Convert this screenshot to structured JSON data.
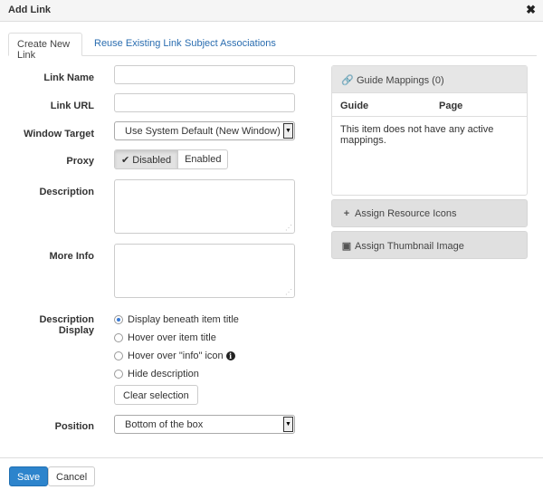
{
  "dialog": {
    "title": "Add Link",
    "close_glyph": "✖"
  },
  "tabs": [
    {
      "label": "Create New Link",
      "active": true
    },
    {
      "label": "Reuse Existing Link",
      "active": false
    },
    {
      "label": "Subject Associations",
      "active": false
    }
  ],
  "form": {
    "link_name": {
      "label": "Link Name",
      "value": ""
    },
    "link_url": {
      "label": "Link URL",
      "value": ""
    },
    "window_target": {
      "label": "Window Target",
      "selected": "Use System Default (New Window)"
    },
    "proxy": {
      "label": "Proxy",
      "options": [
        "Disabled",
        "Enabled"
      ],
      "selected": "Disabled"
    },
    "description": {
      "label": "Description",
      "value": ""
    },
    "more_info": {
      "label": "More Info",
      "value": ""
    },
    "description_display": {
      "label": "Description Display",
      "options": [
        "Display beneath item title",
        "Hover over item title",
        "Hover over \"info\" icon",
        "Hide description"
      ],
      "selected": "Display beneath item title",
      "clear_label": "Clear selection"
    },
    "position": {
      "label": "Position",
      "selected": "Bottom of the box"
    }
  },
  "side": {
    "guide_mappings": {
      "title": "Guide Mappings (0)",
      "columns": [
        "Guide",
        "Page"
      ],
      "empty_message": "This item does not have any active mappings.",
      "icon": "link-icon"
    },
    "resource_icons": {
      "label": "Assign Resource Icons",
      "icon": "plus-icon"
    },
    "thumbnail": {
      "label": "Assign Thumbnail Image",
      "icon": "image-icon"
    }
  },
  "footer": {
    "save_label": "Save",
    "cancel_label": "Cancel"
  },
  "colors": {
    "primary": "#2d84cc",
    "link": "#2a6db0",
    "panel_header": "#e6e6e6"
  }
}
